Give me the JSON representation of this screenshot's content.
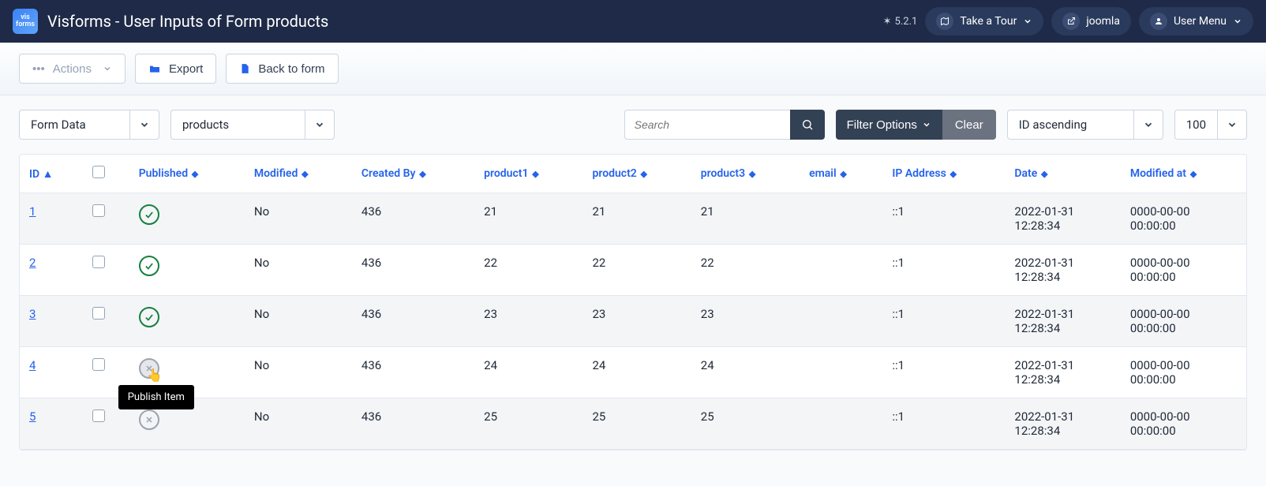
{
  "header": {
    "logo_top": "vis",
    "logo_bottom": "forms",
    "title": "Visforms - User Inputs of Form products",
    "version": "5.2.1",
    "tour": "Take a Tour",
    "site": "joomla",
    "user_menu": "User Menu"
  },
  "toolbar": {
    "actions": "Actions",
    "export": "Export",
    "back": "Back to form"
  },
  "filters": {
    "view": "Form Data",
    "form": "products",
    "search_placeholder": "Search",
    "filter_options": "Filter Options",
    "clear": "Clear",
    "sort": "ID ascending",
    "limit": "100"
  },
  "columns": {
    "id": "ID",
    "published": "Published",
    "modified": "Modified",
    "created_by": "Created By",
    "product1": "product1",
    "product2": "product2",
    "product3": "product3",
    "email": "email",
    "ip": "IP Address",
    "date": "Date",
    "modified_at": "Modified at"
  },
  "tooltip": "Publish Item",
  "rows": [
    {
      "id": "1",
      "published": true,
      "modified": "No",
      "created_by": "436",
      "p1": "21",
      "p2": "21",
      "p3": "21",
      "email": "",
      "ip": "::1",
      "date": "2022-01-31 12:28:34",
      "modified_at": "0000-00-00 00:00:00"
    },
    {
      "id": "2",
      "published": true,
      "modified": "No",
      "created_by": "436",
      "p1": "22",
      "p2": "22",
      "p3": "22",
      "email": "",
      "ip": "::1",
      "date": "2022-01-31 12:28:34",
      "modified_at": "0000-00-00 00:00:00"
    },
    {
      "id": "3",
      "published": true,
      "modified": "No",
      "created_by": "436",
      "p1": "23",
      "p2": "23",
      "p3": "23",
      "email": "",
      "ip": "::1",
      "date": "2022-01-31 12:28:34",
      "modified_at": "0000-00-00 00:00:00"
    },
    {
      "id": "4",
      "published": false,
      "hover": true,
      "modified": "No",
      "created_by": "436",
      "p1": "24",
      "p2": "24",
      "p3": "24",
      "email": "",
      "ip": "::1",
      "date": "2022-01-31 12:28:34",
      "modified_at": "0000-00-00 00:00:00"
    },
    {
      "id": "5",
      "published": false,
      "modified": "No",
      "created_by": "436",
      "p1": "25",
      "p2": "25",
      "p3": "25",
      "email": "",
      "ip": "::1",
      "date": "2022-01-31 12:28:34",
      "modified_at": "0000-00-00 00:00:00"
    }
  ]
}
